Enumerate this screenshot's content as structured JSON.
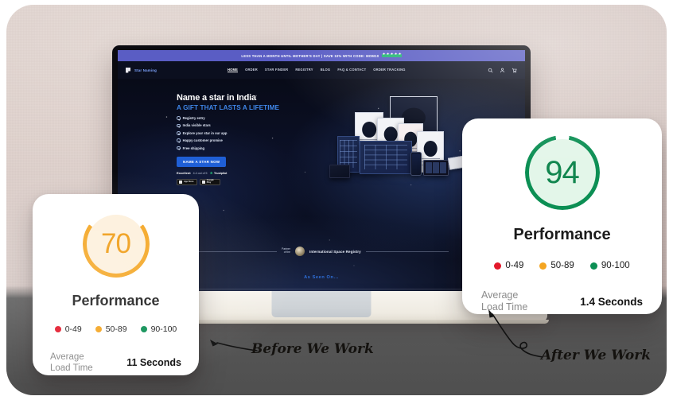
{
  "website": {
    "promo_banner": {
      "text": "LESS THAN A MONTH UNTIL MOTHER'S DAY | SAVE 10% WITH CODE: MOM10",
      "rating_stars": 5,
      "bg_color": "#5a5dc4"
    },
    "brand": "Star Naming",
    "nav_items": [
      {
        "label": "HOME",
        "active": true
      },
      {
        "label": "ORDER",
        "active": false
      },
      {
        "label": "STAR FINDER",
        "active": false
      },
      {
        "label": "REGISTRY",
        "active": false
      },
      {
        "label": "BLOG",
        "active": false
      },
      {
        "label": "FAQ & CONTACT",
        "active": false
      },
      {
        "label": "ORDER TRACKING",
        "active": false
      }
    ],
    "nav_icons": [
      "search-icon",
      "account-icon",
      "cart-icon"
    ],
    "hero": {
      "title": "Name a star in India",
      "subtitle": "A GIFT THAT LASTS A LIFETIME",
      "bullets": [
        "Registry entry",
        "India visible stars",
        "Explore your star in our app",
        "Happy customer promise",
        "Free shipping"
      ],
      "cta_label": "NAME A STAR NOW",
      "trust_word": "Excellent",
      "trust_score": "4.4 out of 5",
      "trust_brand": "Trustpilot",
      "store_badges": [
        "App Store",
        "Google Play"
      ]
    },
    "partner": {
      "prefix_line1": "Partner",
      "prefix_line2": "of the",
      "name": "International Space Registry"
    },
    "as_seen_on": "As Seen On..."
  },
  "cards": [
    {
      "id": "before",
      "score": "70",
      "score_color": "#ef9b12",
      "ring_color": "#f4a521",
      "ring_track": "#fdf0dc",
      "fill_color": "#fdf0dc",
      "percent": 70,
      "title": "Performance",
      "legend": [
        {
          "label": "0-49",
          "color": "#e3192b"
        },
        {
          "label": "50-89",
          "color": "#f4a521"
        },
        {
          "label": "90-100",
          "color": "#0c8f54"
        }
      ],
      "metric_label_line1": "Average",
      "metric_label_line2": "Load Time",
      "metric_value": "11 Seconds"
    },
    {
      "id": "after",
      "score": "94",
      "score_color": "#12864f",
      "ring_color": "#0c8f54",
      "ring_track": "#e3f6e9",
      "fill_color": "#e3f6e9",
      "percent": 94,
      "title": "Performance",
      "legend": [
        {
          "label": "0-49",
          "color": "#e3192b"
        },
        {
          "label": "50-89",
          "color": "#f4a521"
        },
        {
          "label": "90-100",
          "color": "#0c8f54"
        }
      ],
      "metric_label_line1": "Average",
      "metric_label_line2": "Load Time",
      "metric_value": "1.4 Seconds"
    }
  ],
  "annotations": {
    "before": "Before We Work",
    "after": "After We Work"
  },
  "colors": {
    "background_start": "#e6dbd6",
    "background_end": "#cdbcb8",
    "dark_band": "#565656",
    "laptop_bezel": "#0a0a10",
    "laptop_base": "#f7f4ee"
  }
}
